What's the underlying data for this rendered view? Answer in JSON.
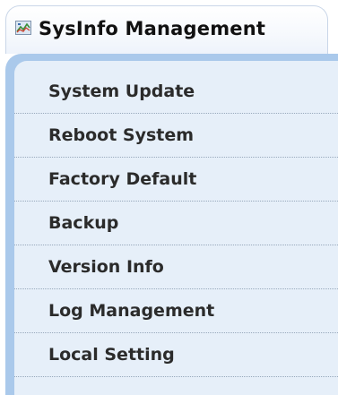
{
  "header": {
    "title": "SysInfo Management",
    "icon": "system-info-icon"
  },
  "menu": {
    "items": [
      {
        "label": "System Update"
      },
      {
        "label": "Reboot System"
      },
      {
        "label": "Factory Default"
      },
      {
        "label": "Backup"
      },
      {
        "label": "Version Info"
      },
      {
        "label": "Log Management"
      },
      {
        "label": "Local Setting"
      }
    ]
  },
  "colors": {
    "panel_border": "#aac9eb",
    "panel_background": "#e6eff9",
    "text": "#2b2b2b"
  }
}
